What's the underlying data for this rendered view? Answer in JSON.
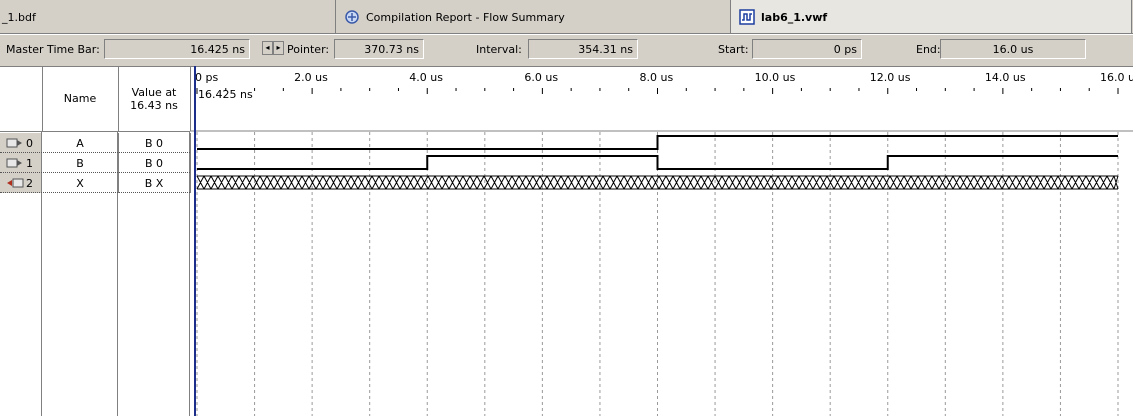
{
  "tabs": {
    "left_label": "_1.bdf",
    "report_label": "Compilation Report - Flow Summary",
    "active_label": "lab6_1.vwf"
  },
  "toolbar": {
    "master_label": "Master Time Bar:",
    "master_value": "16.425 ns",
    "pointer_label": "Pointer:",
    "pointer_value": "370.73 ns",
    "interval_label": "Interval:",
    "interval_value": "354.31 ns",
    "start_label": "Start:",
    "start_value": "0 ps",
    "end_label": "End:",
    "end_value": "16.0 us"
  },
  "grid": {
    "name_header": "Name",
    "value_header_line1": "Value at",
    "value_header_line2": "16.43 ns",
    "cursor_time_label": "16.425 ns",
    "time_ticks": [
      "0 ps",
      "2.0 us",
      "4.0 us",
      "6.0 us",
      "8.0 us",
      "10.0 us",
      "12.0 us",
      "14.0 us",
      "16.0 us"
    ],
    "signals": [
      {
        "index": "0",
        "name": "A",
        "value": "B 0",
        "type": "input"
      },
      {
        "index": "1",
        "name": "B",
        "value": "B 0",
        "type": "input"
      },
      {
        "index": "2",
        "name": "X",
        "value": "B X",
        "type": "output"
      }
    ]
  },
  "waveforms": {
    "A": [
      [
        0,
        0
      ],
      [
        8.0,
        1
      ],
      [
        16.0,
        1
      ]
    ],
    "B": [
      [
        0,
        0
      ],
      [
        4.0,
        1
      ],
      [
        8.0,
        0
      ],
      [
        12.0,
        1
      ],
      [
        16.0,
        1
      ]
    ],
    "X_unknown": true
  },
  "colors": {
    "chrome": "#d4d0c8",
    "cursor": "#1c2e8c",
    "grid_line": "#9a9a9a"
  }
}
